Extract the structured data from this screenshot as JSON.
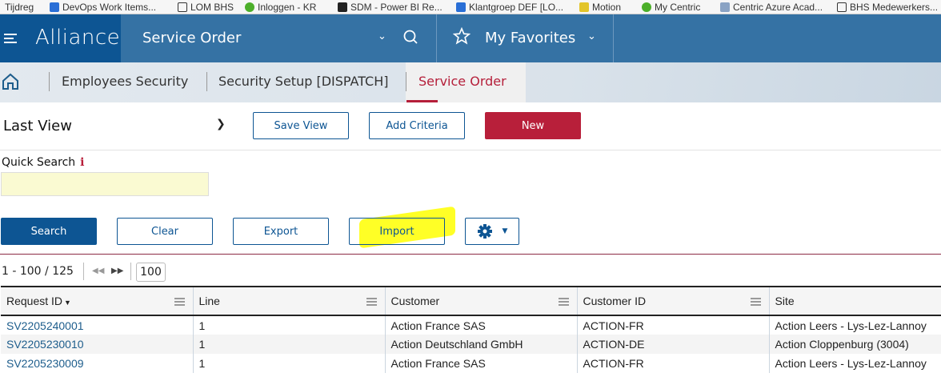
{
  "bookmarks": [
    "Tijdreg",
    "DevOps Work Items...",
    "LOM BHS",
    "Inloggen - KR",
    "SDM - Power BI Re...",
    "Klantgroep DEF [LO...",
    "Motion",
    "My Centric",
    "Centric Azure Acad...",
    "BHS Medewerkers..."
  ],
  "header": {
    "logo": "Alliance",
    "module": "Service Order",
    "favorites": "My Favorites"
  },
  "breadcrumb": [
    "Employees Security",
    "Security Setup [DISPATCH]",
    "Service Order"
  ],
  "toolbar": {
    "view": "Last View",
    "save_view": "Save View",
    "add_criteria": "Add Criteria",
    "new": "New"
  },
  "quick_search": {
    "label": "Quick Search",
    "info": "i",
    "value": ""
  },
  "actions": {
    "search": "Search",
    "clear": "Clear",
    "export": "Export",
    "import": "Import"
  },
  "pagination": {
    "range": "1 - 100 / 125",
    "page_size": "100"
  },
  "colors": {
    "brand": "#0d5593",
    "header": "#3572a4",
    "accent": "#b81f3a",
    "highlight": "#ffff1a"
  },
  "table": {
    "columns": [
      "Request ID",
      "Line",
      "Customer",
      "Customer ID",
      "Site"
    ],
    "rows": [
      [
        "SV2205240001",
        "1",
        "Action France SAS",
        "ACTION-FR",
        "Action Leers - Lys-Lez-Lannoy"
      ],
      [
        "SV2205230010",
        "1",
        "Action Deutschland GmbH",
        "ACTION-DE",
        "Action Cloppenburg (3004)"
      ],
      [
        "SV2205230009",
        "1",
        "Action France SAS",
        "ACTION-FR",
        "Action Leers - Lys-Lez-Lannoy"
      ]
    ]
  }
}
